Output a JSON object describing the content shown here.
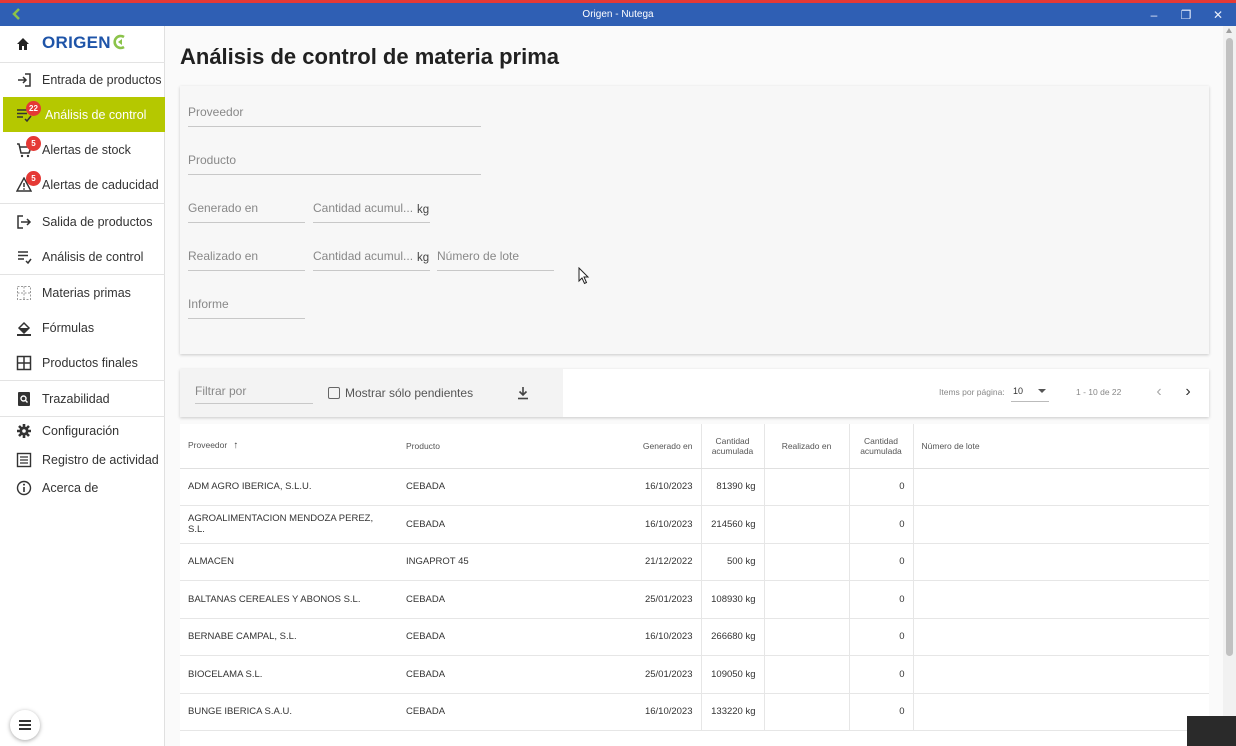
{
  "window": {
    "title": "Origen - Nutega",
    "controls": [
      "–",
      "❐",
      "✕"
    ]
  },
  "brand": {
    "name": "ORIGEN"
  },
  "sidebar": {
    "items": [
      {
        "label": "Entrada de productos",
        "icon": "login-icon"
      },
      {
        "label": "Análisis de control",
        "icon": "checklist-icon",
        "badge": "22",
        "active": true
      },
      {
        "label": "Alertas de stock",
        "icon": "cart-icon",
        "badge": "5"
      },
      {
        "label": "Alertas de caducidad",
        "icon": "warning-icon",
        "badge": "5"
      },
      {
        "label": "Salida de productos",
        "icon": "logout-icon"
      },
      {
        "label": "Análisis de control",
        "icon": "checklist-icon"
      },
      {
        "label": "Materias primas",
        "icon": "grid-dotted-icon"
      },
      {
        "label": "Fórmulas",
        "icon": "paint-bucket-icon"
      },
      {
        "label": "Productos finales",
        "icon": "grid-icon"
      },
      {
        "label": "Trazabilidad",
        "icon": "search-doc-icon"
      },
      {
        "label": "Configuración",
        "icon": "gear-icon"
      },
      {
        "label": "Registro de actividad",
        "icon": "list-box-icon"
      },
      {
        "label": "Acerca de",
        "icon": "info-icon"
      }
    ]
  },
  "page": {
    "title": "Análisis de control de materia prima"
  },
  "filters": {
    "proveedor": "Proveedor",
    "producto": "Producto",
    "generado_en": "Generado en",
    "cantidad_acumulada_1": "Cantidad acumul...",
    "unit_1": "kg",
    "realizado_en": "Realizado en",
    "cantidad_acumulada_2": "Cantidad acumul...",
    "unit_2": "kg",
    "numero_lote": "Número de lote",
    "informe": "Informe"
  },
  "toolbar": {
    "filter_placeholder": "Filtrar por",
    "only_pending": "Mostrar sólo pendientes",
    "items_per_page_label": "Items por página:",
    "items_per_page": "10",
    "range": "1 - 10 de 22",
    "prev": "‹",
    "next": "›"
  },
  "table": {
    "headers": {
      "proveedor": "Proveedor",
      "producto": "Producto",
      "generado_en": "Generado en",
      "cantidad_1": "Cantidad acumulada",
      "realizado_en": "Realizado en",
      "cantidad_2": "Cantidad acumulada",
      "numero_lote": "Número de lote"
    },
    "sort_indicator": "↑",
    "rows": [
      {
        "proveedor": "ADM AGRO IBERICA, S.L.U.",
        "producto": "CEBADA",
        "generado": "16/10/2023",
        "cantidad": "81390 kg",
        "realizado": "",
        "cantidad2": "0",
        "lote": ""
      },
      {
        "proveedor": "AGROALIMENTACION MENDOZA PEREZ, S.L.",
        "producto": "CEBADA",
        "generado": "16/10/2023",
        "cantidad": "214560 kg",
        "realizado": "",
        "cantidad2": "0",
        "lote": ""
      },
      {
        "proveedor": "ALMACEN",
        "producto": "INGAPROT 45",
        "generado": "21/12/2022",
        "cantidad": "500 kg",
        "realizado": "",
        "cantidad2": "0",
        "lote": ""
      },
      {
        "proveedor": "BALTANAS CEREALES Y ABONOS S.L.",
        "producto": "CEBADA",
        "generado": "25/01/2023",
        "cantidad": "108930 kg",
        "realizado": "",
        "cantidad2": "0",
        "lote": ""
      },
      {
        "proveedor": "BERNABE CAMPAL, S.L.",
        "producto": "CEBADA",
        "generado": "16/10/2023",
        "cantidad": "266680 kg",
        "realizado": "",
        "cantidad2": "0",
        "lote": ""
      },
      {
        "proveedor": "BIOCELAMA S.L.",
        "producto": "CEBADA",
        "generado": "25/01/2023",
        "cantidad": "109050 kg",
        "realizado": "",
        "cantidad2": "0",
        "lote": ""
      },
      {
        "proveedor": "BUNGE IBERICA S.A.U.",
        "producto": "CEBADA",
        "generado": "16/10/2023",
        "cantidad": "133220 kg",
        "realizado": "",
        "cantidad2": "0",
        "lote": ""
      }
    ]
  },
  "colors": {
    "titlebar": "#2f5fb4",
    "accent": "#b5c800",
    "brand": "#1e54a8",
    "badge": "#e53935"
  }
}
